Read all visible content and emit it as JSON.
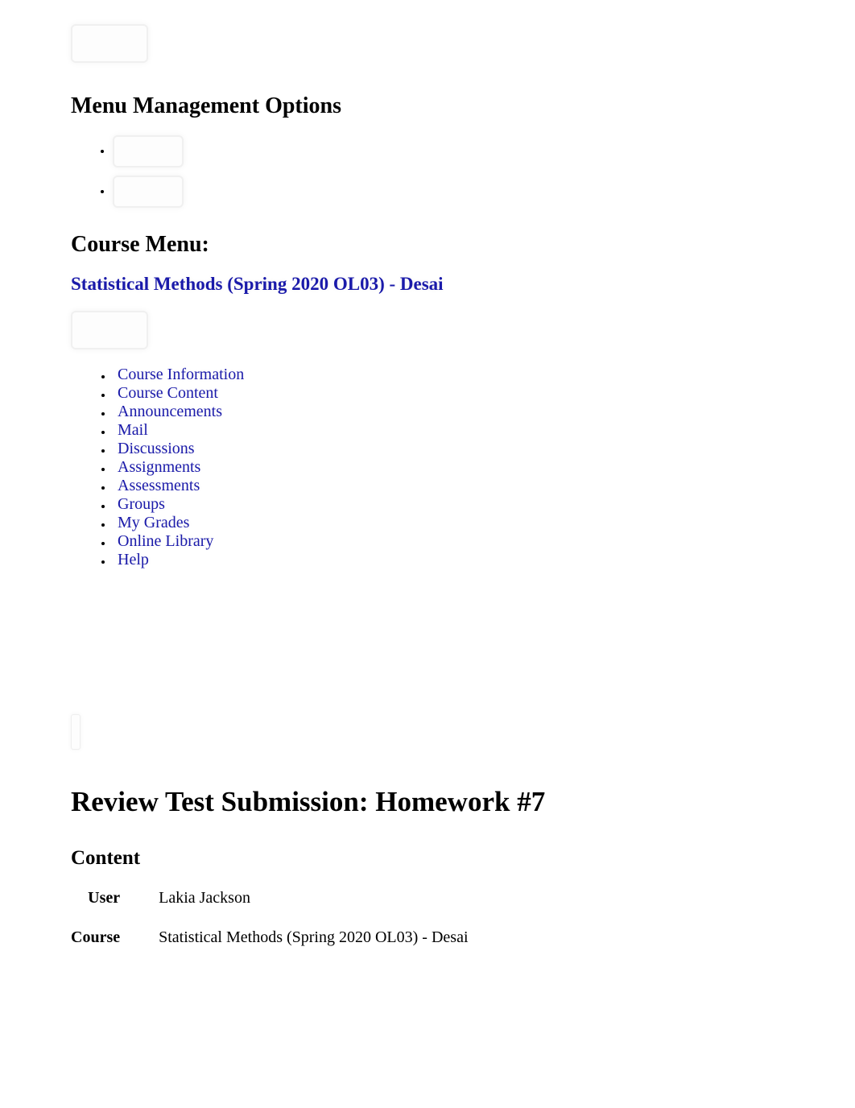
{
  "headings": {
    "menu_mgmt": "Menu Management Options",
    "course_menu": "Course Menu:",
    "content": "Content"
  },
  "course_link": "Statistical Methods (Spring 2020 OL03) - Desai",
  "nav": {
    "items": [
      "Course Information",
      "Course Content",
      "Announcements",
      "Mail",
      "Discussions",
      "Assignments",
      "Assessments",
      "Groups",
      "My Grades",
      "Online Library",
      "Help"
    ]
  },
  "page_title": "Review Test Submission: Homework #7",
  "details": {
    "user_label": "User",
    "user_value": "Lakia Jackson",
    "course_label": "Course",
    "course_value": "Statistical Methods (Spring 2020 OL03) - Desai"
  }
}
